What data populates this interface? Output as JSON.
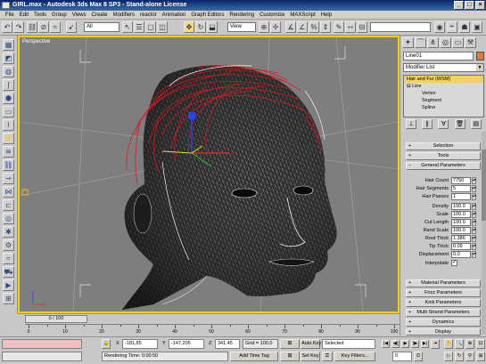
{
  "window": {
    "title": "GIRL.max - Autodesk 3ds Max 8 SP3 - Stand-alone License"
  },
  "menu": [
    "File",
    "Edit",
    "Tools",
    "Group",
    "Views",
    "Create",
    "Modifiers",
    "reactor",
    "Animation",
    "Graph Editors",
    "Rendering",
    "Customize",
    "MAXScript",
    "Help"
  ],
  "toolbar": {
    "selection_filter": "All",
    "ref_coord": "View"
  },
  "viewport": {
    "label": "Perspective"
  },
  "command_panel": {
    "object_name": "Line01",
    "object_color": "#e87a30",
    "modifier_list": "Modifier List",
    "stack": [
      {
        "label": "Hair and Fur (WSM)",
        "selected": true,
        "level": 0
      },
      {
        "label": "Line",
        "selected": false,
        "level": 0
      },
      {
        "label": "Vertex",
        "selected": false,
        "level": 1
      },
      {
        "label": "Segment",
        "selected": false,
        "level": 1
      },
      {
        "label": "Spline",
        "selected": false,
        "level": 1
      }
    ],
    "rollouts_top": [
      "Selection",
      "Tools",
      "General Parameters"
    ],
    "params": [
      {
        "label": "Hair Count",
        "value": "7750"
      },
      {
        "label": "Hair Segments",
        "value": "5"
      },
      {
        "label": "Hair Passes",
        "value": "1"
      },
      {
        "label": "Density",
        "value": "100.0"
      },
      {
        "label": "Scale",
        "value": "100.0"
      },
      {
        "label": "Cut Length",
        "value": "100.0"
      },
      {
        "label": "Rand Scale",
        "value": "100.0"
      },
      {
        "label": "Root Thick",
        "value": "1.386"
      },
      {
        "label": "Tip Thick",
        "value": "0.09"
      },
      {
        "label": "Displacement",
        "value": "0.0"
      }
    ],
    "interpolate_label": "Interpolate",
    "interpolate_checked": true,
    "rollouts_bottom": [
      "Material Parameters",
      "Frizz Parameters",
      "Kink Parameters",
      "Multi Strand Parameters",
      "Dynamics",
      "Display"
    ]
  },
  "timeline": {
    "frame_display": "0 / 100"
  },
  "trackbar_ticks": [
    "0",
    "10",
    "20",
    "30",
    "40",
    "50",
    "60",
    "70",
    "80",
    "90",
    "100"
  ],
  "status": {
    "x_label": "X",
    "x_value": "-181,85",
    "y_label": "Y",
    "y_value": "-147,205",
    "z_label": "Z",
    "z_value": "341,45",
    "grid": "Grid = 100,0",
    "render_time": "Rendering Time: 0:00:50",
    "add_time_tag": "Add Time Tag",
    "auto_key": "Auto Key",
    "set_key": "Set Key",
    "selected": "Selected",
    "key_filters": "Key Filters...",
    "frame": "0"
  }
}
